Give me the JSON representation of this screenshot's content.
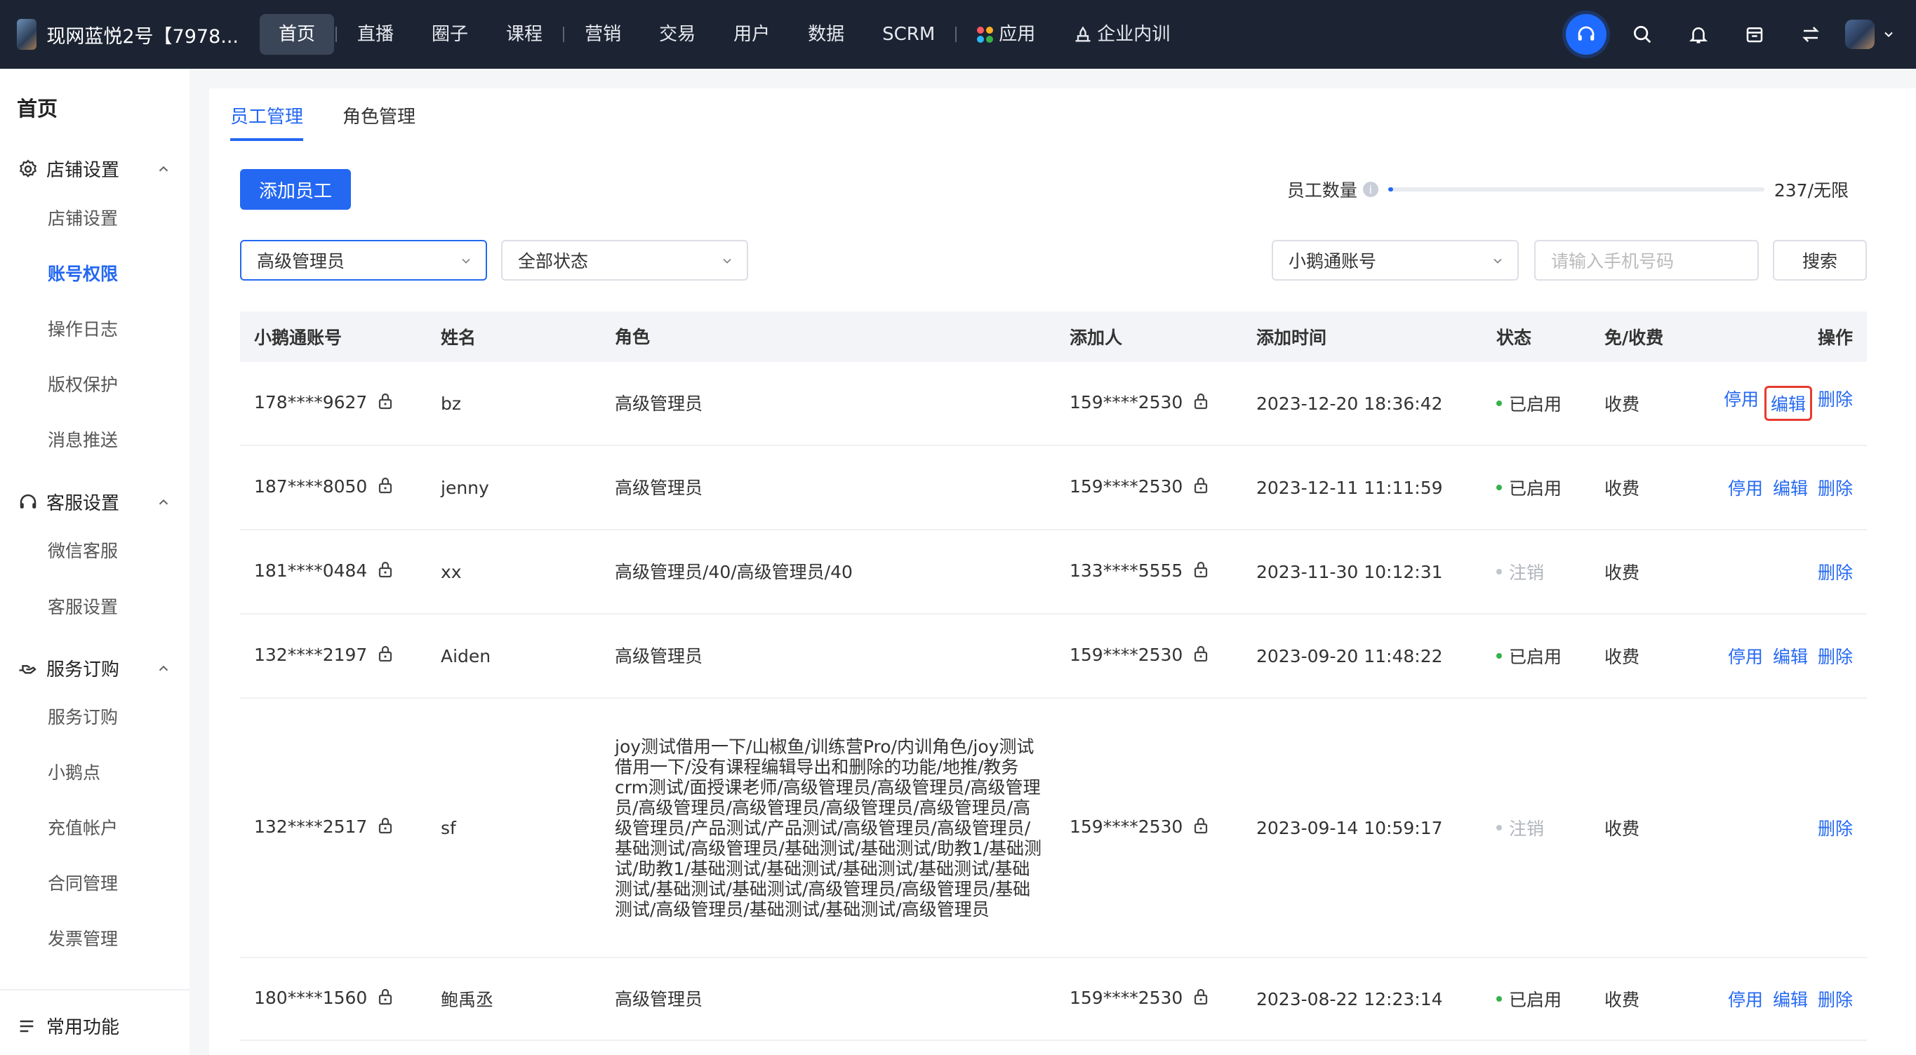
{
  "topbar": {
    "shop_name": "现网蓝悦2号【7978...",
    "nav": [
      "首页",
      "直播",
      "圈子",
      "课程",
      "营销",
      "交易",
      "用户",
      "数据",
      "SCRM",
      "应用",
      "企业内训"
    ],
    "apps_colors": [
      "#ff5a5f",
      "#ffb020",
      "#2db7f5",
      "#36b24a"
    ]
  },
  "sidebar": {
    "home": "首页",
    "groups": [
      {
        "label": "店铺设置",
        "items": [
          "店铺设置",
          "账号权限",
          "操作日志",
          "版权保护",
          "消息推送"
        ]
      },
      {
        "label": "客服设置",
        "items": [
          "微信客服",
          "客服设置"
        ]
      },
      {
        "label": "服务订购",
        "items": [
          "服务订购",
          "小鹅点",
          "充值帐户",
          "合同管理",
          "发票管理"
        ]
      }
    ],
    "active_item": "账号权限",
    "bottom": "常用功能"
  },
  "tabs": [
    "员工管理",
    "角色管理"
  ],
  "toolbar": {
    "add_button": "添加员工",
    "quota_label": "员工数量",
    "quota_text": "237/无限",
    "quota_fill_fraction": 0.013
  },
  "filters": {
    "role_select": "高级管理员",
    "status_select": "全部状态",
    "account_select": "小鹅通账号",
    "phone_placeholder": "请输入手机号码",
    "search_button": "搜索"
  },
  "table": {
    "headers": [
      "小鹅通账号",
      "姓名",
      "角色",
      "添加人",
      "添加时间",
      "状态",
      "免/收费",
      "操作"
    ],
    "rows": [
      {
        "account": "178****9627",
        "name": "bz",
        "role": "高级管理员",
        "adder": "159****2530",
        "time": "2023-12-20 18:36:42",
        "status": "已启用",
        "fee": "收费",
        "ops": [
          "停用",
          "编辑",
          "删除"
        ]
      },
      {
        "account": "187****8050",
        "name": "jenny",
        "role": "高级管理员",
        "adder": "159****2530",
        "time": "2023-12-11 11:11:59",
        "status": "已启用",
        "fee": "收费",
        "ops": [
          "停用",
          "编辑",
          "删除"
        ]
      },
      {
        "account": "181****0484",
        "name": "xx",
        "role": "高级管理员/40/高级管理员/40",
        "adder": "133****5555",
        "time": "2023-11-30 10:12:31",
        "status": "注销",
        "fee": "收费",
        "ops": [
          "删除"
        ]
      },
      {
        "account": "132****2197",
        "name": "Aiden",
        "role": "高级管理员",
        "adder": "159****2530",
        "time": "2023-09-20 11:48:22",
        "status": "已启用",
        "fee": "收费",
        "ops": [
          "停用",
          "编辑",
          "删除"
        ]
      },
      {
        "account": "132****2517",
        "name": "sf",
        "role": "joy测试借用一下/山椒鱼/训练营Pro/内训角色/joy测试借用一下/没有课程编辑导出和删除的功能/地推/教务crm测试/面授课老师/高级管理员/高级管理员/高级管理员/高级管理员/高级管理员/高级管理员/高级管理员/高级管理员/产品测试/产品测试/高级管理员/高级管理员/基础测试/高级管理员/基础测试/基础测试/助教1/基础测试/助教1/基础测试/基础测试/基础测试/基础测试/基础测试/基础测试/基础测试/高级管理员/高级管理员/基础测试/高级管理员/基础测试/基础测试/高级管理员",
        "adder": "159****2530",
        "time": "2023-09-14 10:59:17",
        "status": "注销",
        "fee": "收费",
        "ops": [
          "删除"
        ]
      },
      {
        "account": "180****1560",
        "name": "鲍禹丞",
        "role": "高级管理员",
        "adder": "159****2530",
        "time": "2023-08-22 12:23:14",
        "status": "已启用",
        "fee": "收费",
        "ops": [
          "停用",
          "编辑",
          "删除"
        ]
      }
    ]
  },
  "colors": {
    "accent": "#2468f2",
    "topbar": "#1c2433",
    "enabled": "#36b24a",
    "highlight": "#e83a2f"
  }
}
